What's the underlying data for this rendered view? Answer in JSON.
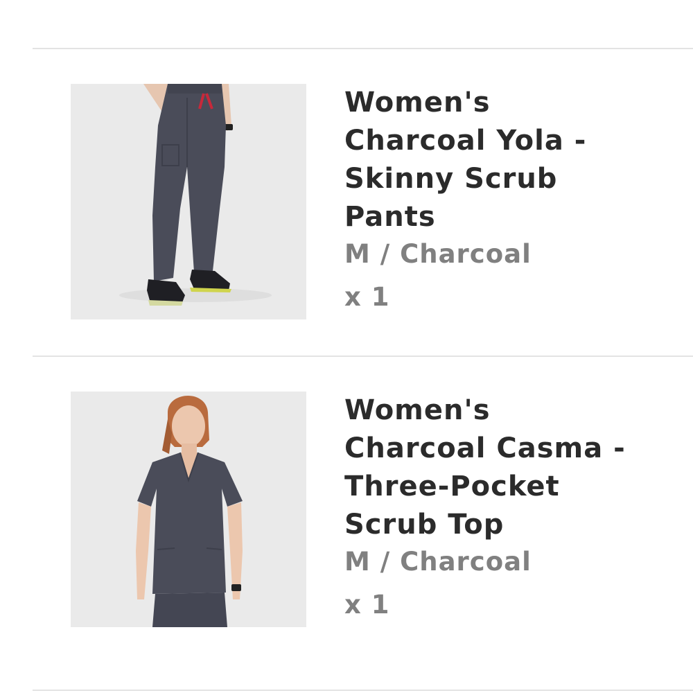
{
  "cart": {
    "items": [
      {
        "title": "Women's Charcoal Yola - Skinny Scrub Pants",
        "variant": "M / Charcoal",
        "quantity": "x 1",
        "image": "product-photo-skinny-scrub-pants"
      },
      {
        "title": "Women's Charcoal Casma - Three-Pocket Scrub Top",
        "variant": "M / Charcoal",
        "quantity": "x 1",
        "image": "product-photo-three-pocket-scrub-top"
      }
    ]
  },
  "colors": {
    "title_text": "#2b2b2b",
    "secondary_text": "#808080",
    "divider": "#e3e3e3",
    "image_background": "#e9e9e9",
    "charcoal_fabric": "#4a4c59",
    "drawstring": "#c8283a"
  }
}
